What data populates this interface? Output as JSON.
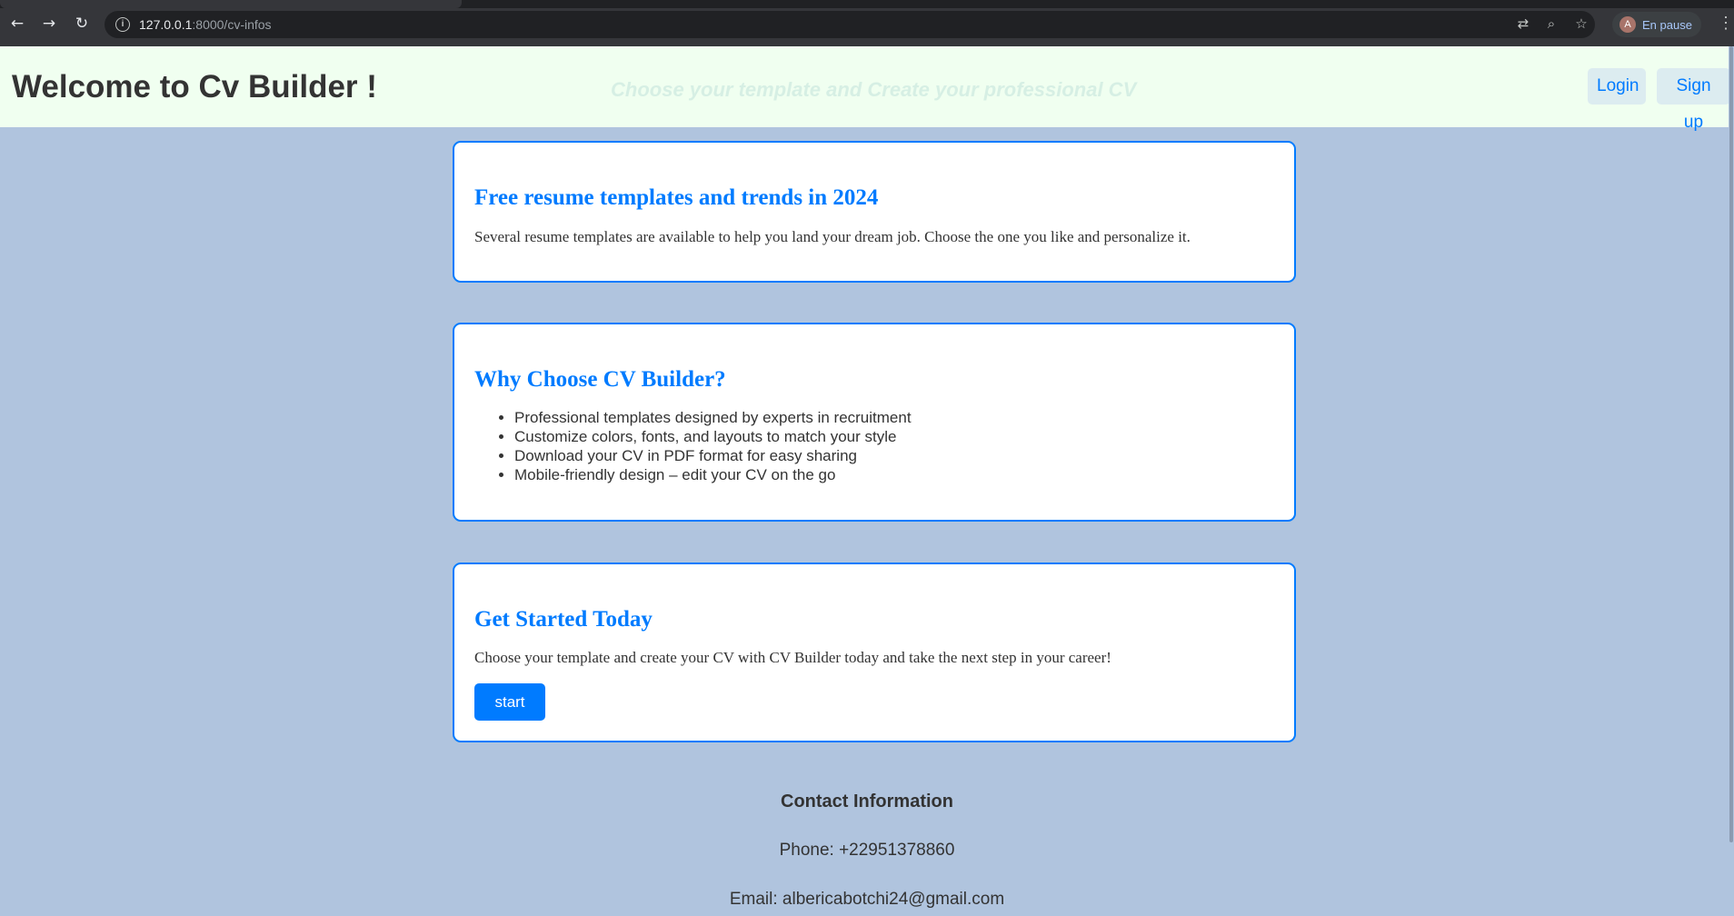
{
  "browser": {
    "url_host": "127.0.0.1",
    "url_path": ":8000/cv-infos",
    "profile_initial": "A",
    "profile_status": "En pause"
  },
  "header": {
    "title": "Welcome to Cv Builder !",
    "tagline": "Choose your template and Create your professional CV",
    "login_label": "Login",
    "signup_label": "Sign up"
  },
  "cards": {
    "templates": {
      "title": "Free resume templates and trends in 2024",
      "text": "Several resume templates are available to help you land your dream job. Choose the one you like and personalize it."
    },
    "why": {
      "title": "Why Choose CV Builder?",
      "items": [
        "Professional templates designed by experts in recruitment",
        "Customize colors, fonts, and layouts to match your style",
        "Download your CV in PDF format for easy sharing",
        "Mobile-friendly design – edit your CV on the go"
      ]
    },
    "start": {
      "title": "Get Started Today",
      "text": "Choose your template and create your CV with CV Builder today and take the next step in your career!",
      "button_label": "start"
    }
  },
  "contact": {
    "title": "Contact Information",
    "phone": "Phone: +22951378860",
    "email": "Email: albericabotchi24@gmail.com"
  },
  "colors": {
    "page_bg": "#b0c4de",
    "header_bg": "#f0fff0",
    "accent": "#007bff"
  }
}
